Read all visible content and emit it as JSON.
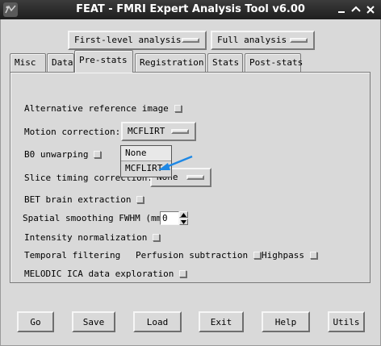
{
  "window": {
    "title": "FEAT - FMRI Expert Analysis Tool v6.00",
    "app_icon": "fsl-logo-icon",
    "controls": [
      "minimize-icon",
      "maximize-icon",
      "close-icon"
    ]
  },
  "top_menus": {
    "analysis_level": "First-level analysis",
    "analysis_type": "Full analysis"
  },
  "tabs": [
    {
      "label": "Misc",
      "active": false
    },
    {
      "label": "Data",
      "active": false
    },
    {
      "label": "Pre-stats",
      "active": true
    },
    {
      "label": "Registration",
      "active": false
    },
    {
      "label": "Stats",
      "active": false
    },
    {
      "label": "Post-stats",
      "active": false
    }
  ],
  "prestats": {
    "alt_ref_label": "Alternative reference image",
    "motion_label": "Motion correction:",
    "motion_value": "MCFLIRT",
    "b0_label": "B0 unwarping",
    "slice_timing_label": "Slice timing correction:",
    "slice_timing_value": "None",
    "bet_label": "BET brain extraction",
    "smoothing_label": "Spatial smoothing FWHM (mm)",
    "smoothing_value": "0",
    "intensity_label": "Intensity normalization",
    "temporal_label": "Temporal filtering",
    "perfusion_label": "Perfusion subtraction",
    "highpass_label": "Highpass",
    "melodic_label": "MELODIC ICA data exploration"
  },
  "motion_dropdown": {
    "options": [
      "None",
      "MCFLIRT"
    ],
    "highlighted": "MCFLIRT",
    "pointer_color": "#1e88e5"
  },
  "buttons": {
    "go": "Go",
    "save": "Save",
    "load": "Load",
    "exit": "Exit",
    "help": "Help",
    "utils": "Utils"
  }
}
